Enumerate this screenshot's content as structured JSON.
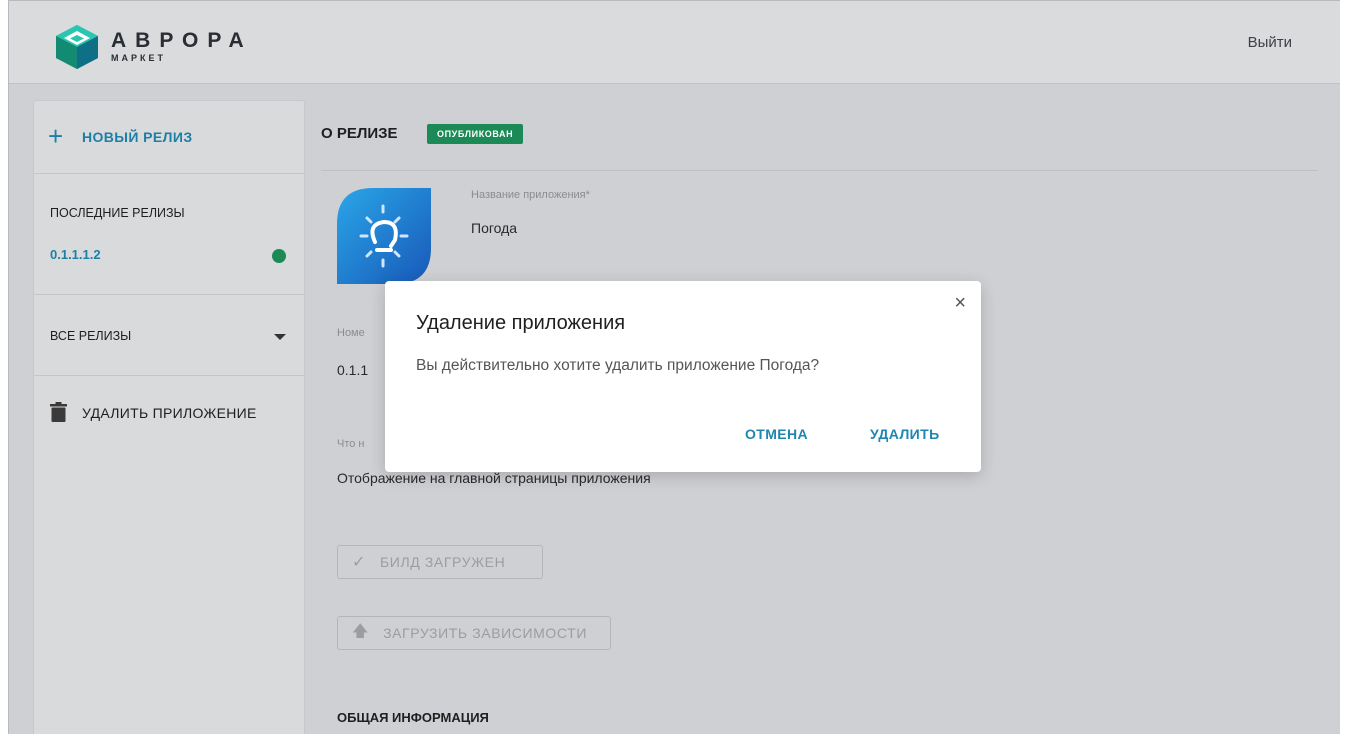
{
  "header": {
    "brand_main": "АВРОРА",
    "brand_sub": "МАРКЕТ",
    "logout_label": "Выйти"
  },
  "sidebar": {
    "new_release_label": "НОВЫЙ РЕЛИЗ",
    "recent_title": "ПОСЛЕДНИЕ РЕЛИЗЫ",
    "recent_version": "0.1.1.1.2",
    "all_releases_label": "ВСЕ РЕЛИЗЫ",
    "delete_app_label": "УДАЛИТЬ ПРИЛОЖЕНИЕ"
  },
  "main": {
    "about_title": "О РЕЛИЗЕ",
    "status_badge": "ОПУБЛИКОВАН",
    "app_name_label": "Название приложения*",
    "app_name_value": "Погода",
    "number_label": "Номе",
    "number_value": "0.1.1",
    "whats_new_label": "Что н",
    "whats_new_value": "Отображение на главной страницы приложения",
    "build_uploaded_label": "БИЛД ЗАГРУЖЕН",
    "upload_deps_label": "ЗАГРУЗИТЬ ЗАВИСИМОСТИ",
    "general_info_title": "ОБЩАЯ ИНФОРМАЦИЯ"
  },
  "modal": {
    "title": "Удаление приложения",
    "text": "Вы действительно хотите удалить приложение Погода?",
    "cancel_label": "ОТМЕНА",
    "delete_label": "УДАЛИТЬ",
    "close_glyph": "×"
  },
  "colors": {
    "accent": "#1e7fa6",
    "published": "#1c8a56",
    "overlay_bg": "#cfd0d3"
  }
}
